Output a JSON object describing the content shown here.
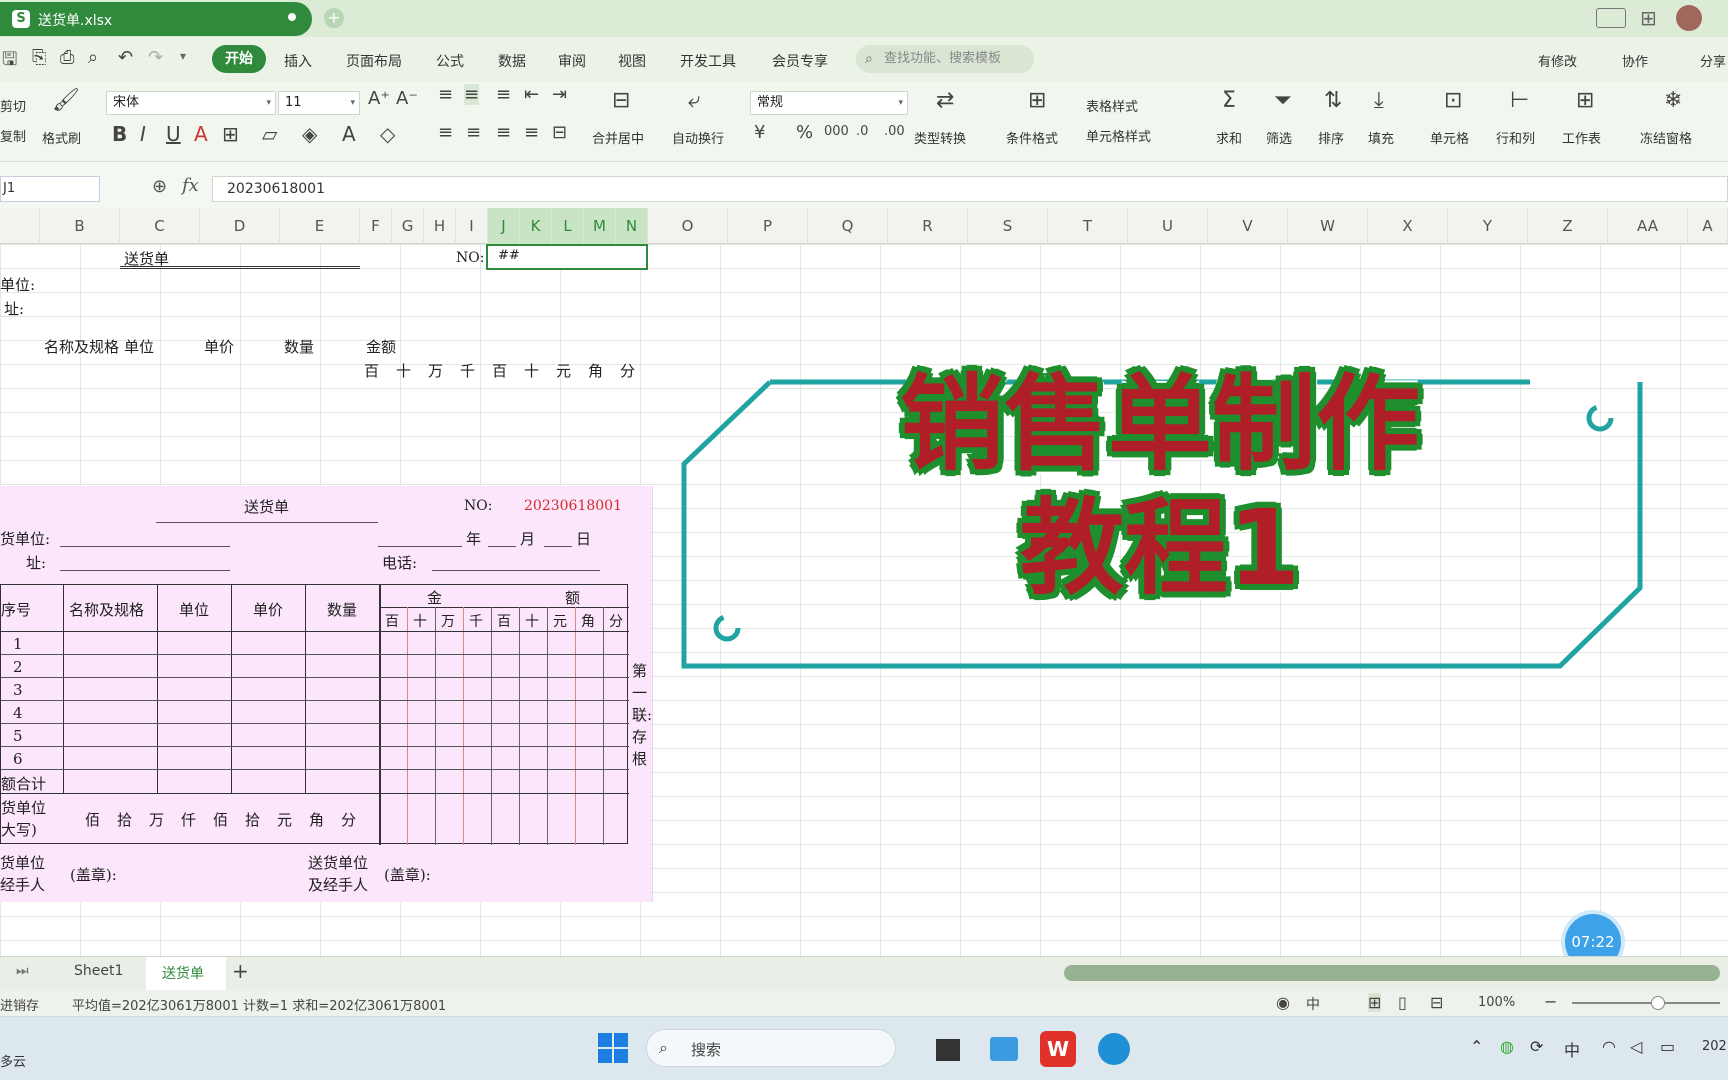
{
  "titlebar": {
    "file_name": "送货单.xlsx"
  },
  "menu": {
    "start": "开始",
    "items": [
      "插入",
      "页面布局",
      "公式",
      "数据",
      "审阅",
      "视图",
      "开发工具",
      "会员专享"
    ],
    "search_placeholder": "查找功能、搜索模板",
    "right": [
      "有修改",
      "协作",
      "分享"
    ]
  },
  "ribbon": {
    "cut": "剪切",
    "copy": "复制",
    "format_painter": "格式刷",
    "font_name": "宋体",
    "font_size": "11",
    "merge": "合并居中",
    "wrap": "自动换行",
    "number_format": "常规",
    "type_convert": "类型转换",
    "cond_format": "条件格式",
    "table_style": "表格样式",
    "cell_style": "单元格样式",
    "sum": "求和",
    "filter": "筛选",
    "sort": "排序",
    "fill": "填充",
    "cell": "单元格",
    "rowcol": "行和列",
    "worksheet": "工作表",
    "freeze": "冻结窗格"
  },
  "formula_bar": {
    "name_box": "J1",
    "fx": "fx",
    "value": "20230618001"
  },
  "columns": [
    "B",
    "C",
    "D",
    "E",
    "F",
    "G",
    "H",
    "I",
    "J",
    "K",
    "L",
    "M",
    "N",
    "O",
    "P",
    "Q",
    "R",
    "S",
    "T",
    "U",
    "V",
    "W",
    "X",
    "Y",
    "Z",
    "AA",
    "A"
  ],
  "cells": {
    "c1": "送货单",
    "no_label": "NO:",
    "no_value": "##",
    "unit": "单位:",
    "addr": "址:",
    "h_name": "名称及规格",
    "h_unit": "单位",
    "h_price": "单价",
    "h_qty": "数量",
    "h_amount": "金额",
    "digits": [
      "百",
      "十",
      "万",
      "千",
      "百",
      "十",
      "元",
      "角",
      "分"
    ]
  },
  "invoice": {
    "title": "送货单",
    "no_label": "NO:",
    "no_value": "20230618001",
    "unit_label": "货单位:",
    "addr_label": "址:",
    "phone_label": "电话:",
    "date_year": "年",
    "date_month": "月",
    "date_day": "日",
    "headers": [
      "序号",
      "名称及规格",
      "单位",
      "单价",
      "数量"
    ],
    "amount_head_1": "金",
    "amount_head_2": "额",
    "digits": [
      "百",
      "十",
      "万",
      "千",
      "百",
      "十",
      "元",
      "角",
      "分"
    ],
    "rows": [
      "1",
      "2",
      "3",
      "4",
      "5",
      "6"
    ],
    "total_label": "额合计",
    "upper_label_1": "货单位",
    "upper_label_2": "大写)",
    "upper_units": [
      "佰",
      "拾",
      "万",
      "仟",
      "佰",
      "拾",
      "元",
      "角",
      "分"
    ],
    "copy_note": "第一联:存根",
    "sign_left_1": "货单位",
    "sign_left_2": "经手人",
    "sign_left_stamp": "(盖章):",
    "sign_right_1": "送货单位",
    "sign_right_2": "及经手人",
    "sign_right_stamp": "(盖章):"
  },
  "overlay": {
    "line1": "销售单制作",
    "line2": "教程1",
    "timer": "07:22"
  },
  "sheets": {
    "tab1": "Sheet1",
    "tab2": "送货单",
    "add": "+"
  },
  "status": {
    "left": "进销存",
    "stats": "平均值=202亿3061万8001  计数=1  求和=202亿3061万8001",
    "zoom": "100%"
  },
  "taskbar": {
    "search": "搜索",
    "weather": "多云",
    "ime": "中",
    "year": "202"
  },
  "colors": {
    "accent": "#2f8a3c",
    "invoice_bg": "#fbe6fb",
    "title_red": "#b01e28",
    "frame": "#1fa3a3"
  }
}
